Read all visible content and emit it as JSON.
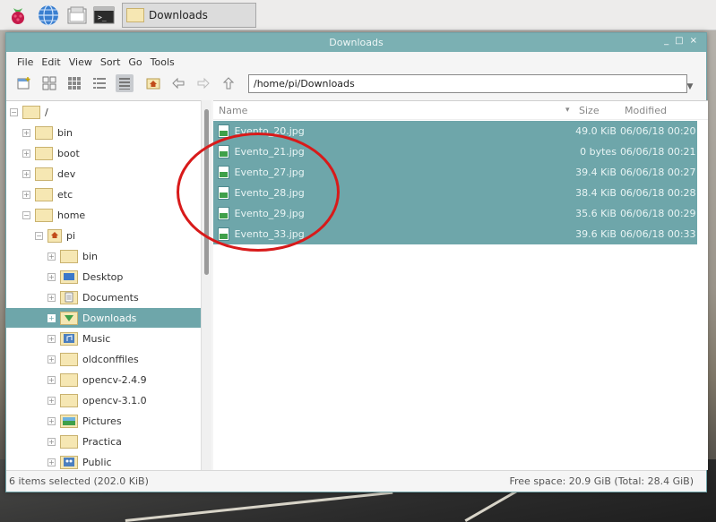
{
  "taskbar": {
    "launchers": [
      {
        "name": "raspberry-menu",
        "icon": "raspberry-icon"
      },
      {
        "name": "web-browser",
        "icon": "globe-icon"
      },
      {
        "name": "file-manager",
        "icon": "folder-icon"
      },
      {
        "name": "terminal",
        "icon": "terminal-icon"
      }
    ],
    "task_label": "Downloads"
  },
  "window": {
    "title": "Downloads",
    "controls": {
      "minimize": "_",
      "maximize": "□",
      "close": "×"
    }
  },
  "menu": [
    "File",
    "Edit",
    "View",
    "Sort",
    "Go",
    "Tools"
  ],
  "toolbar": {
    "path": "/home/pi/Downloads",
    "view_modes": [
      "icon-view",
      "thumbnail-view",
      "compact-view",
      "detailed-list-view"
    ],
    "active_view": "detailed-list-view"
  },
  "tree": {
    "items": [
      {
        "label": "/",
        "depth": 0,
        "expand": "−",
        "kind": "folder"
      },
      {
        "label": "bin",
        "depth": 1,
        "expand": "+",
        "kind": "folder"
      },
      {
        "label": "boot",
        "depth": 1,
        "expand": "+",
        "kind": "folder"
      },
      {
        "label": "dev",
        "depth": 1,
        "expand": "+",
        "kind": "folder"
      },
      {
        "label": "etc",
        "depth": 1,
        "expand": "+",
        "kind": "folder"
      },
      {
        "label": "home",
        "depth": 1,
        "expand": "−",
        "kind": "folder"
      },
      {
        "label": "pi",
        "depth": 2,
        "expand": "−",
        "kind": "home"
      },
      {
        "label": "bin",
        "depth": 3,
        "expand": "+",
        "kind": "folder"
      },
      {
        "label": "Desktop",
        "depth": 3,
        "expand": "+",
        "kind": "desktop"
      },
      {
        "label": "Documents",
        "depth": 3,
        "expand": "+",
        "kind": "documents"
      },
      {
        "label": "Downloads",
        "depth": 3,
        "expand": "+",
        "kind": "downloads",
        "selected": true
      },
      {
        "label": "Music",
        "depth": 3,
        "expand": "+",
        "kind": "music"
      },
      {
        "label": "oldconffiles",
        "depth": 3,
        "expand": "+",
        "kind": "folder"
      },
      {
        "label": "opencv-2.4.9",
        "depth": 3,
        "expand": "+",
        "kind": "folder"
      },
      {
        "label": "opencv-3.1.0",
        "depth": 3,
        "expand": "+",
        "kind": "folder"
      },
      {
        "label": "Pictures",
        "depth": 3,
        "expand": "+",
        "kind": "pictures"
      },
      {
        "label": "Practica",
        "depth": 3,
        "expand": "+",
        "kind": "folder"
      },
      {
        "label": "Public",
        "depth": 3,
        "expand": "+",
        "kind": "public"
      }
    ]
  },
  "columns": {
    "name": "Name",
    "sort_arrow": "▾",
    "size": "Size",
    "modified": "Modified"
  },
  "files": [
    {
      "name": "Evento_20.jpg",
      "size": "49.0 KiB",
      "modified": "06/06/18 00:20"
    },
    {
      "name": "Evento_21.jpg",
      "size": "0 bytes",
      "modified": "06/06/18 00:21"
    },
    {
      "name": "Evento_27.jpg",
      "size": "39.4 KiB",
      "modified": "06/06/18 00:27"
    },
    {
      "name": "Evento_28.jpg",
      "size": "38.4 KiB",
      "modified": "06/06/18 00:28"
    },
    {
      "name": "Evento_29.jpg",
      "size": "35.6 KiB",
      "modified": "06/06/18 00:29"
    },
    {
      "name": "Evento_33.jpg",
      "size": "39.6 KiB",
      "modified": "06/06/18 00:33"
    }
  ],
  "status": {
    "left": "6 items selected (202.0 KiB)",
    "right": "Free space: 20.9 GiB (Total: 28.4 GiB)"
  },
  "colors": {
    "accent": "#6ea6aa",
    "titlebar": "#7bb0b3",
    "annotation": "#d81a1a"
  }
}
